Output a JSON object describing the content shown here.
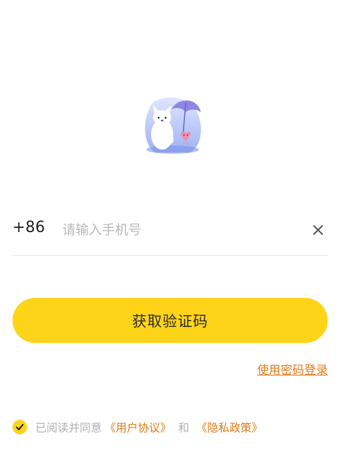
{
  "login": {
    "country_code": "+86",
    "phone_placeholder": "请输入手机号",
    "phone_value": "",
    "get_code_label": "获取验证码",
    "password_login_label": "使用密码登录"
  },
  "agreement": {
    "checked": true,
    "prefix": "已阅读并同意",
    "user_agreement_label": "《用户协议》",
    "and_text": "和",
    "privacy_label": "《隐私政策》"
  },
  "icons": {
    "mascot": "cat-with-umbrella-illustration",
    "clear": "close-icon",
    "check": "checkmark-icon"
  },
  "colors": {
    "accent": "#fed419",
    "link": "#e07a16",
    "placeholder": "#b8b8b8"
  }
}
